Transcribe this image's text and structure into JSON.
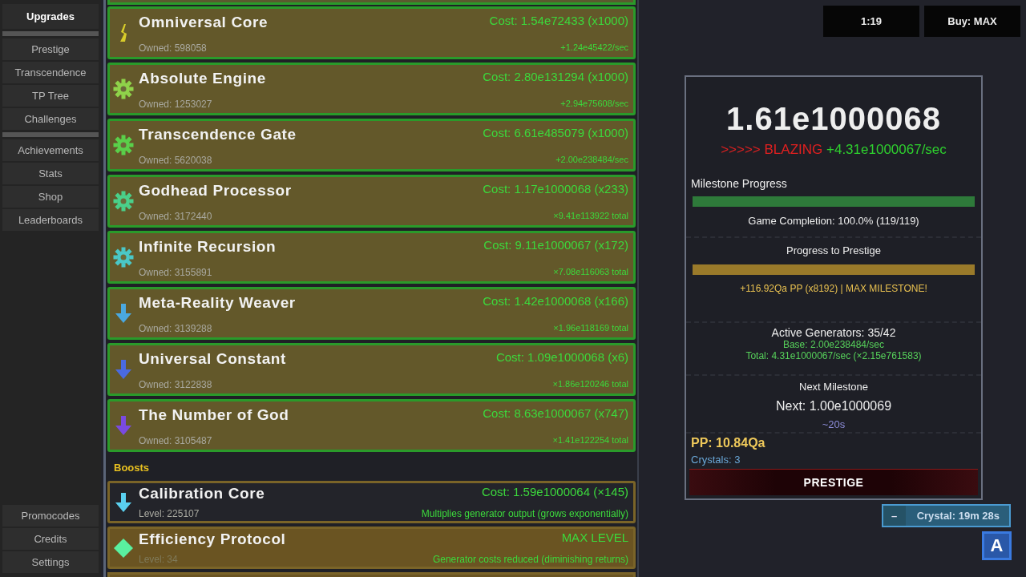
{
  "sidebar": {
    "groups": [
      [
        {
          "label": "Upgrades",
          "selected": true
        }
      ],
      [
        {
          "label": "Prestige",
          "selected": false
        },
        {
          "label": "Transcendence",
          "selected": false
        },
        {
          "label": "TP Tree",
          "selected": false
        },
        {
          "label": "Challenges",
          "selected": false
        }
      ],
      [
        {
          "label": "Achievements",
          "selected": false
        },
        {
          "label": "Stats",
          "selected": false
        },
        {
          "label": "Shop",
          "selected": false
        },
        {
          "label": "Leaderboards",
          "selected": false
        }
      ]
    ],
    "bottom_items": [
      {
        "label": "Promocodes",
        "selected": false
      },
      {
        "label": "Credits",
        "selected": false
      },
      {
        "label": "Settings",
        "selected": false
      }
    ]
  },
  "generators": [
    {
      "name": "Omniversal Core",
      "owned": "Owned: 598058",
      "cost": "Cost: 1.54e72433 (x1000)",
      "output": "+1.24e45422/sec",
      "kind": "bolt",
      "color": "#d8cc2a"
    },
    {
      "name": "Absolute Engine",
      "owned": "Owned: 1253027",
      "cost": "Cost: 2.80e131294 (x1000)",
      "output": "+2.94e75608/sec",
      "kind": "gear",
      "color": "#8fd34a"
    },
    {
      "name": "Transcendence Gate",
      "owned": "Owned: 5620038",
      "cost": "Cost: 6.61e485079 (x1000)",
      "output": "+2.00e238484/sec",
      "kind": "gear",
      "color": "#5ad04a"
    },
    {
      "name": "Godhead Processor",
      "owned": "Owned: 3172440",
      "cost": "Cost: 1.17e1000068 (x233)",
      "output": "×9.41e113922 total",
      "kind": "gear",
      "color": "#4ad08a"
    },
    {
      "name": "Infinite Recursion",
      "owned": "Owned: 3155891",
      "cost": "Cost: 9.11e1000067 (x172)",
      "output": "×7.08e116063 total",
      "kind": "gear",
      "color": "#4ac8c8"
    },
    {
      "name": "Meta-Reality Weaver",
      "owned": "Owned: 3139288",
      "cost": "Cost: 1.42e1000068 (x166)",
      "output": "×1.96e118169 total",
      "kind": "arrow",
      "color": "#4aa8e0"
    },
    {
      "name": "Universal Constant",
      "owned": "Owned: 3122838",
      "cost": "Cost: 1.09e1000068 (x6)",
      "output": "×1.86e120246 total",
      "kind": "arrow",
      "color": "#4a6ae0"
    },
    {
      "name": "The Number of God",
      "owned": "Owned: 3105487",
      "cost": "Cost: 8.63e1000067 (x747)",
      "output": "×1.41e122254 total",
      "kind": "arrow",
      "color": "#7a4ae0"
    }
  ],
  "boosts_heading": "Boosts",
  "boosts": [
    {
      "name": "Calibration Core",
      "level": "Level: 225107",
      "cost": "Cost: 1.59e1000064 (×145)",
      "effect": "Multiplies generator output (grows exponentially)",
      "maxed": false,
      "kind": "arrow",
      "color": "#5ad0f0"
    },
    {
      "name": "Efficiency Protocol",
      "level": "Level: 34",
      "cost": "MAX LEVEL",
      "effect": "Generator costs reduced (diminishing returns)",
      "maxed": true,
      "kind": "diamond",
      "color": "#5af0a0"
    }
  ],
  "timer": "1:19",
  "buy_mode": "Buy: MAX",
  "stats": {
    "amount": "1.61e1000068",
    "speed": ">>>>> BLAZING",
    "rate": "+4.31e1000067/sec",
    "milestone": {
      "title": "Milestone Progress",
      "level": 1,
      "caption": "Game Completion: 100.0% (119/119)"
    },
    "prestige_progress": {
      "title": "Progress to Prestige",
      "level": 1,
      "caption": "+116.92Qa PP (x8192) | MAX MILESTONE!"
    },
    "generators_info": {
      "active": "Active Generators: 35/42",
      "base": "Base: 2.00e238484/sec",
      "total": "Total: 4.31e1000067/sec (×2.15e761583)"
    },
    "next_milestone": {
      "title": "Next Milestone",
      "value": "Next: 1.00e1000069",
      "eta": "~20s"
    },
    "pp": "PP: 10.84Qa",
    "crystals": "Crystals: 3",
    "prestige_button": "PRESTIGE"
  },
  "crystal_timer": {
    "toggle": "–",
    "label": "Crystal: 19m 28s"
  },
  "auto_button": "A"
}
